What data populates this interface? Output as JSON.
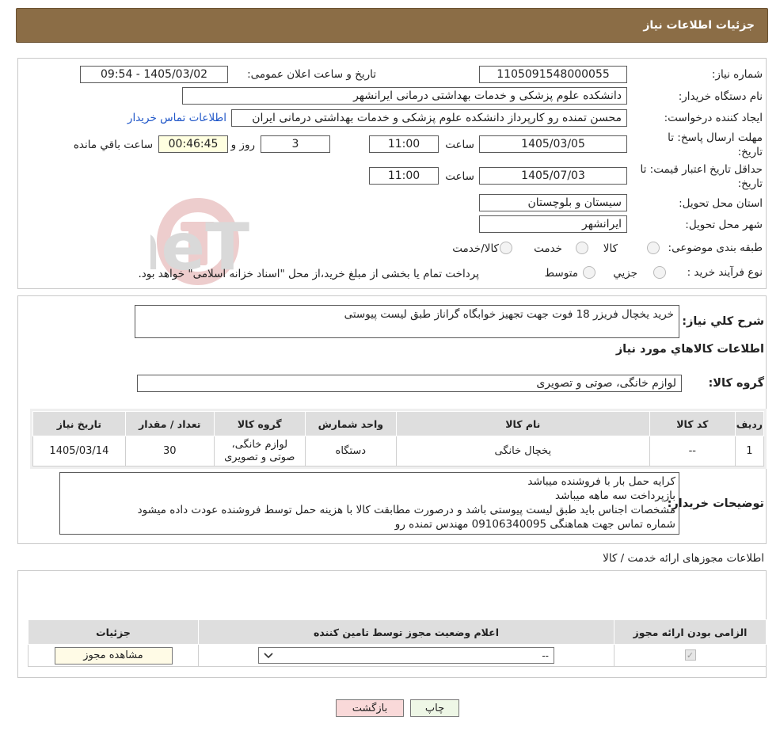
{
  "page_title": "جزئیات اطلاعات نیاز",
  "fields": {
    "need_number_label": "شماره نیاز:",
    "need_number": "1105091548000055",
    "announce_label": "تاریخ و ساعت اعلان عمومی:",
    "announce_value": "1405/03/02 - 09:54",
    "buyer_org_label": "نام دستگاه خریدار:",
    "buyer_org": "دانشکده علوم پزشکی و خدمات بهداشتی درمانی ایرانشهر",
    "requester_label": "ایجاد کننده درخواست:",
    "requester": "محسن تمنده رو کارپرداز دانشکده علوم پزشکی و خدمات بهداشتی درمانی ایران",
    "contact_link": "اطلاعات تماس خریدار",
    "reply_deadline_label_1": "مهلت ارسال پاسخ: تا",
    "reply_deadline_label_2": "تاریخ:",
    "reply_date": "1405/03/05",
    "time_label": "ساعت",
    "reply_time": "11:00",
    "days_value": "3",
    "days_label": "روز و",
    "remaining_time": "00:46:45",
    "remaining_label": "ساعت باقي مانده",
    "price_validity_label_1": "حداقل تاریخ اعتبار قیمت: تا",
    "price_validity_label_2": "تاریخ:",
    "price_date": "1405/07/03",
    "price_time": "11:00",
    "province_label": "استان محل تحویل:",
    "province": "سیستان و بلوچستان",
    "city_label": "شهر محل تحویل:",
    "city": "ایرانشهر",
    "category_label": "طبقه بندی موضوعی:",
    "category_options": [
      "کالا",
      "خدمت",
      "کالا/خدمت"
    ],
    "process_label": "نوع فرآیند خرید :",
    "process_options": [
      "جزیي",
      "متوسط"
    ],
    "process_note": "پرداخت تمام یا بخشی از مبلغ خرید،از محل \"اسناد خزانه اسلامی\" خواهد بود."
  },
  "summary": {
    "label": "شرح کلي نیاز:",
    "text": "خرید یخچال فریزر 18 فوت جهت تجهیز خوابگاه گراناز طبق لیست پیوستی"
  },
  "goods_section_title": "اطلاعات کالاهاي مورد نیاز",
  "goods_group": {
    "label": "گروه کالا:",
    "value": "لوازم خانگی، صوتی و تصویری"
  },
  "goods_table": {
    "headers": [
      "ردیف",
      "کد کالا",
      "نام کالا",
      "واحد شمارش",
      "گروه کالا",
      "تعداد / مقدار",
      "تاریخ نیاز"
    ],
    "rows": [
      {
        "row": "1",
        "code": "--",
        "name": "یخچال خانگی",
        "unit": "دستگاه",
        "group_line1": "لوازم خانگی،",
        "group_line2": "صوتی و تصویری",
        "qty": "30",
        "date": "1405/03/14"
      }
    ]
  },
  "buyer_notes": {
    "label": "توضیحات خریدار:",
    "lines": [
      "کرایه حمل بار با فروشنده میباشد",
      "بازپرداخت سه ماهه میباشد",
      "مشخصات اجناس باید طبق لیست پیوستی باشد و درصورت مطابقت کالا با هزینه حمل توسط فروشنده عودت داده میشود",
      "شماره تماس جهت هماهنگی 09106340095 مهندس تمنده رو"
    ]
  },
  "permits": {
    "title": "اطلاعات مجوزهای ارائه خدمت / کالا",
    "headers": [
      "الزامی بودن ارائه مجوز",
      "اعلام وضعیت مجوز توسط تامین کننده",
      "جزئیات"
    ],
    "select_value": "--",
    "view_button": "مشاهده مجوز"
  },
  "buttons": {
    "print": "چاپ",
    "back": "بازگشت"
  },
  "watermark_text": "AriaTender.neT",
  "colors": {
    "title_bar": "#8b6d46",
    "link": "#1f56c8",
    "back_button": "#f9d9d9",
    "print_button": "#eef7e6",
    "remaining_box": "#ffffe0"
  }
}
